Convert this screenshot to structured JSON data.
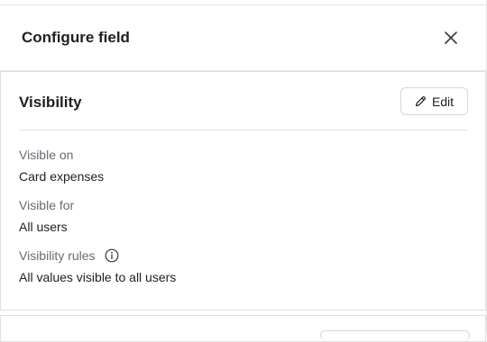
{
  "header": {
    "title": "Configure field",
    "close_icon": "close-icon"
  },
  "visibility": {
    "title": "Visibility",
    "edit_label": "Edit",
    "edit_icon": "pencil-icon",
    "fields": [
      {
        "label": "Visible on",
        "value": "Card expenses"
      },
      {
        "label": "Visible for",
        "value": "All users"
      },
      {
        "label": "Visibility rules",
        "value": "All values visible to all users",
        "icon": "info-icon"
      }
    ]
  }
}
